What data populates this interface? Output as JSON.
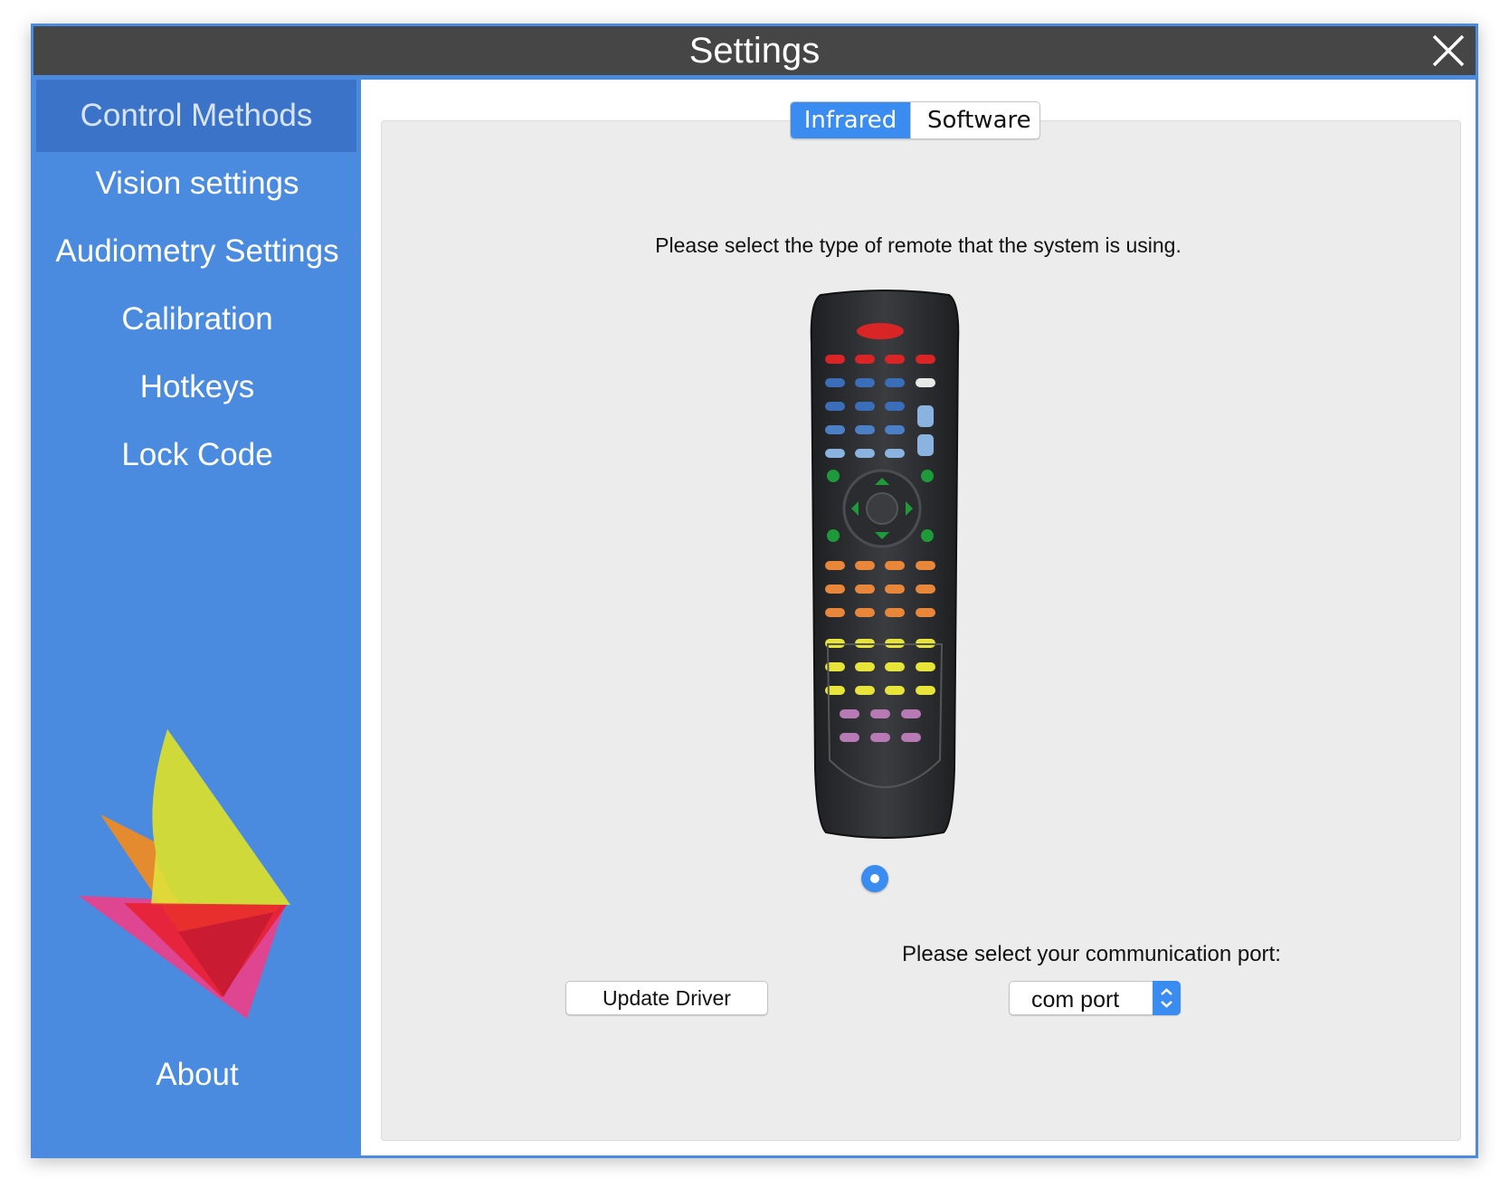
{
  "window": {
    "title": "Settings"
  },
  "sidebar": {
    "items": [
      {
        "label": "Control Methods",
        "active": true
      },
      {
        "label": "Vision settings"
      },
      {
        "label": "Audiometry Settings"
      },
      {
        "label": "Calibration"
      },
      {
        "label": "Hotkeys"
      },
      {
        "label": "Lock Code"
      }
    ],
    "about_label": "About"
  },
  "tabs": {
    "infrared": "Infrared",
    "software": "Software",
    "selected": "Infrared"
  },
  "main": {
    "prompt": "Please select the type of remote that the system is using.",
    "remote_selected": true,
    "update_driver_label": "Update Driver",
    "port_label": "Please select your communication port:",
    "port_value": "com port"
  },
  "colors": {
    "accent": "#4a8be0",
    "sidebar_active": "#3b73c8",
    "titlebar": "#464646",
    "control_blue": "#3a8cf0"
  },
  "icons": {
    "close": "close-icon",
    "remote": "remote-control-image",
    "logo": "app-logo",
    "select_arrows": "updown-chevron-icon"
  }
}
